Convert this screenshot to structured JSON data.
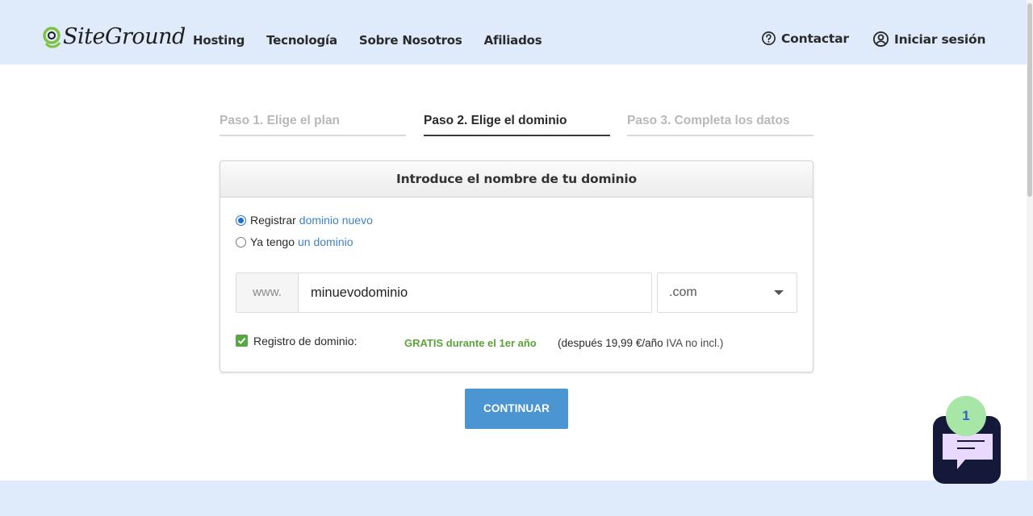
{
  "header": {
    "logo_text": "SiteGround",
    "nav": [
      "Hosting",
      "Tecnología",
      "Sobre Nosotros",
      "Afiliados"
    ],
    "contact_label": "Contactar",
    "login_label": "Iniciar sesión"
  },
  "steps": [
    {
      "label": "Paso 1. Elige el plan",
      "state": "inactive"
    },
    {
      "label": "Paso 2. Elige el dominio",
      "state": "active"
    },
    {
      "label": "Paso 3. Completa los datos",
      "state": "inactive"
    }
  ],
  "domain_card": {
    "title": "Introduce el nombre de tu dominio",
    "option_register": {
      "prefix": "Registrar",
      "link": "dominio nuevo",
      "selected": true
    },
    "option_existing": {
      "prefix": "Ya tengo",
      "link": "un dominio",
      "selected": false
    },
    "www_prefix": "www.",
    "domain_value": "minuevodominio",
    "tld_value": ".com",
    "registration_label": "Registro de dominio:",
    "registration_checked": true,
    "free_text": "GRATIS durante el 1er año",
    "price_text": "(después 19,99 €/año",
    "price_iva": "IVA no incl.)"
  },
  "continue_label": "CONTINUAR",
  "chat": {
    "badge_count": "1"
  },
  "colors": {
    "header_bg": "#dfeafa",
    "accent_blue": "#4b95d3",
    "green": "#5ca33a",
    "chat_bg": "#14193a",
    "badge_bg": "#a7e6a6"
  },
  "icons": {
    "contact": "help-circle-icon",
    "login": "user-circle-icon",
    "logo": "siteground-logo-icon",
    "dropdown": "caret-down-icon",
    "check": "check-icon",
    "chat": "chat-bubble-icon"
  }
}
